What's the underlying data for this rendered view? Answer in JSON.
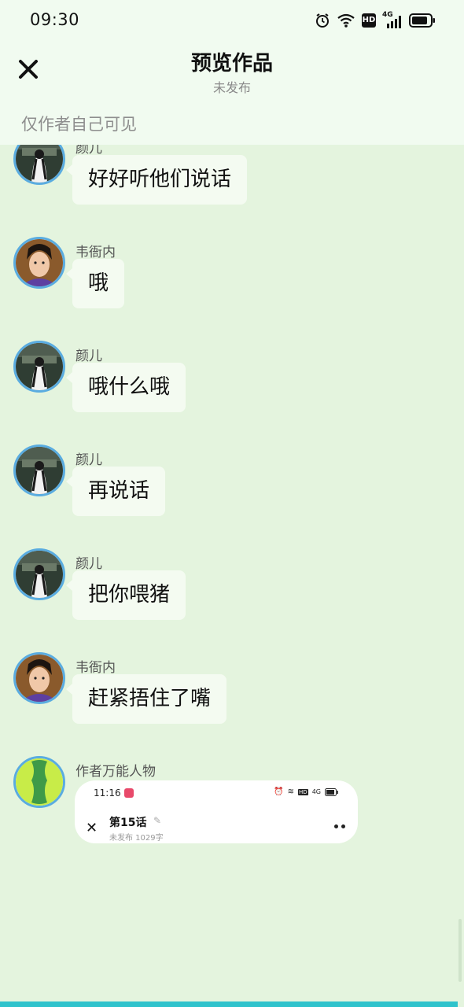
{
  "status_bar": {
    "time": "09:30",
    "icons": [
      "alarm-icon",
      "wifi-icon",
      "hd-icon",
      "signal-4g-icon",
      "battery-icon"
    ],
    "hd_label": "HD",
    "network_label": "4G"
  },
  "header": {
    "title": "预览作品",
    "subtitle": "未发布",
    "visibility_note": "仅作者自己可见",
    "close_icon": "close-icon"
  },
  "messages": [
    {
      "sender": "颜儿",
      "text": "好好听他们说话",
      "avatar": "female"
    },
    {
      "sender": "韦衙内",
      "text": "哦",
      "avatar": "male"
    },
    {
      "sender": "颜儿",
      "text": "哦什么哦",
      "avatar": "female"
    },
    {
      "sender": "颜儿",
      "text": "再说话",
      "avatar": "female"
    },
    {
      "sender": "颜儿",
      "text": "把你喂猪",
      "avatar": "female"
    },
    {
      "sender": "韦衙内",
      "text": "赶紧捂住了嘴",
      "avatar": "male"
    },
    {
      "sender": "作者万能人物",
      "avatar": "green",
      "image": {
        "time": "11:16",
        "hd_label": "HD",
        "network_label": "4G",
        "title": "第15话",
        "subtitle": "未发布 1029字"
      }
    }
  ],
  "colors": {
    "background": "#e4f4de",
    "header": "#f1fbf0",
    "bubble": "#f4fbf1",
    "avatar_border": "#5aace0",
    "bottom_bar": "#2fc3cc"
  }
}
